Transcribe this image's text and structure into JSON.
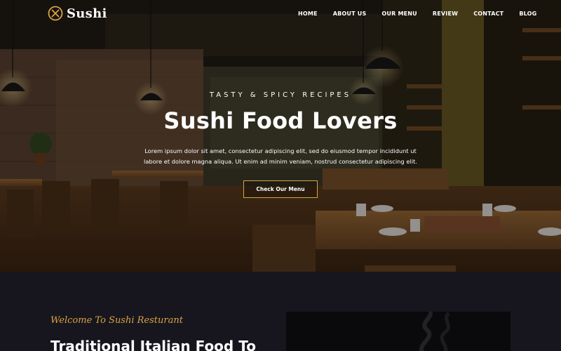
{
  "brand": {
    "name": "Sushi",
    "accent_color": "#d9a441",
    "logo_icon": "crossed-utensils-icon"
  },
  "nav": {
    "items": [
      {
        "label": "HOME"
      },
      {
        "label": "ABOUT US"
      },
      {
        "label": "OUR MENU"
      },
      {
        "label": "REVIEW"
      },
      {
        "label": "CONTACT"
      },
      {
        "label": "BLOG"
      }
    ]
  },
  "hero": {
    "eyebrow": "TASTY & SPICY RECIPES",
    "title": "Sushi Food Lovers",
    "description": "Lorem ipsum dolor sit amet, consectetur adipiscing elit, sed do eiusmod tempor incididunt ut labore et dolore magna aliqua. Ut enim ad minim veniam, nostrud consectetur adipiscing elit.",
    "cta_label": "Check Our Menu"
  },
  "about": {
    "kicker": "Welcome To Sushi Resturant",
    "heading": "Traditional Italian Food To"
  }
}
